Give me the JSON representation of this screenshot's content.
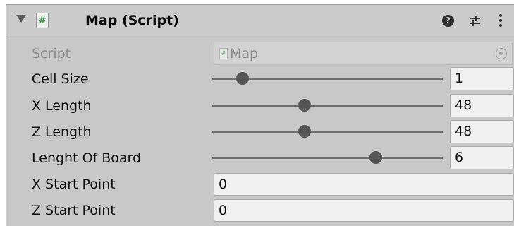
{
  "component": {
    "title": "Map (Script)",
    "icon": "script-icon",
    "enabled_icon_glyph": "#",
    "help_icon_glyph": "?",
    "actions": [
      "help-icon",
      "presets-icon",
      "more-options-icon"
    ]
  },
  "fields": {
    "script": {
      "label": "Script",
      "value": "Map",
      "disabled": true
    },
    "cell_size": {
      "label": "Cell Size",
      "value": "1",
      "slider_fraction": 0.13
    },
    "x_length": {
      "label": "X Length",
      "value": "48",
      "slider_fraction": 0.4
    },
    "z_length": {
      "label": "Z Length",
      "value": "48",
      "slider_fraction": 0.4
    },
    "length_of_board": {
      "label": "Lenght Of Board",
      "value": "6",
      "slider_fraction": 0.71
    },
    "x_start_point": {
      "label": "X Start Point",
      "value": "0"
    },
    "z_start_point": {
      "label": "Z Start Point",
      "value": "0"
    }
  },
  "colors": {
    "panel_background": "#c8c8c8",
    "input_background": "#f0f0f0",
    "script_icon_green": "#3f9b4a",
    "disabled_text": "#8a8a8a"
  }
}
